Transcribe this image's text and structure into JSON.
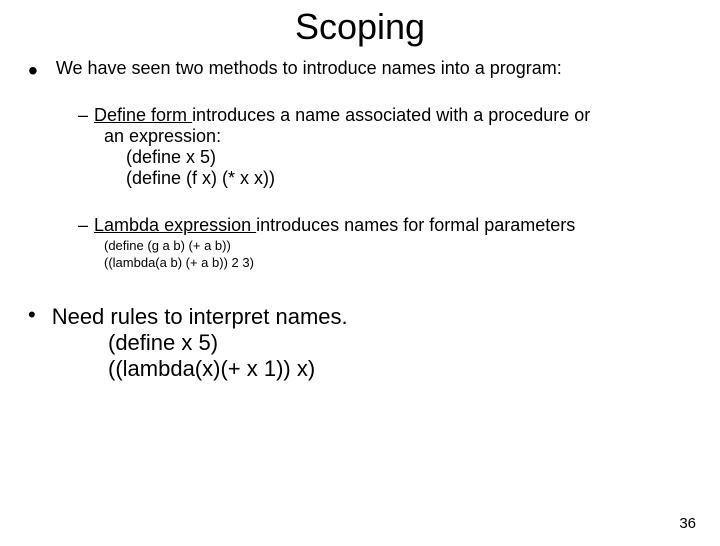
{
  "title": "Scoping",
  "b1": "We have seen two methods to introduce names into a program:",
  "sub1": {
    "lead_underlined": "Define form ",
    "rest": "introduces a name associated with a procedure or",
    "rest2": "an expression:",
    "code1": "(define x 5)",
    "code2": "(define (f x) (* x x))"
  },
  "sub2": {
    "lead_underlined": "Lambda expression ",
    "rest": "introduces names for formal parameters",
    "small1": "(define (g a b) (+ a b))",
    "small2": "((lambda(a b) (+ a b)) 2 3)"
  },
  "b2": "Need rules to interpret names.",
  "b2_code1": "(define x 5)",
  "b2_code2": "((lambda(x)(+ x 1)) x)",
  "page": "36"
}
